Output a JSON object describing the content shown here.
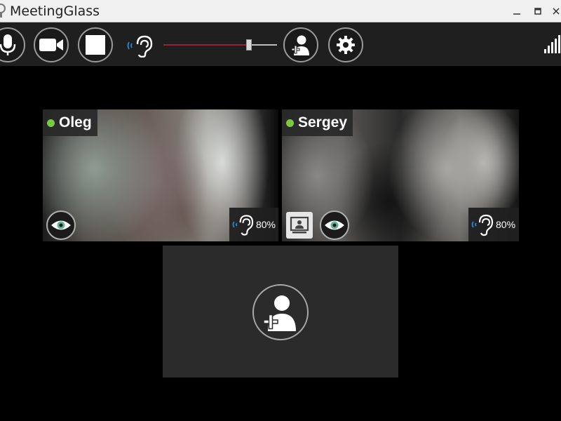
{
  "window": {
    "title": "MeetingGlass"
  },
  "toolbar": {
    "microphone_icon": "microphone-icon",
    "camera_icon": "video-camera-icon",
    "stop_icon": "stop-icon",
    "volume_icon": "ear-volume-icon",
    "volume_level": 0.75,
    "invite_icon": "add-user-icon",
    "settings_icon": "gear-icon",
    "signal_icon": "signal-bars-icon",
    "accent_color": "#9c1f3a"
  },
  "participants": [
    {
      "name": "Oleg",
      "status_color": "#7ac943",
      "hearing_level": "80%",
      "show_screen_share": false
    },
    {
      "name": "Sergey",
      "status_color": "#7ac943",
      "hearing_level": "80%",
      "show_screen_share": true
    }
  ],
  "add_participant": {
    "icon": "add-user-icon"
  },
  "colors": {
    "eye_iris": "#5fb49a",
    "status_online": "#7ac943"
  }
}
